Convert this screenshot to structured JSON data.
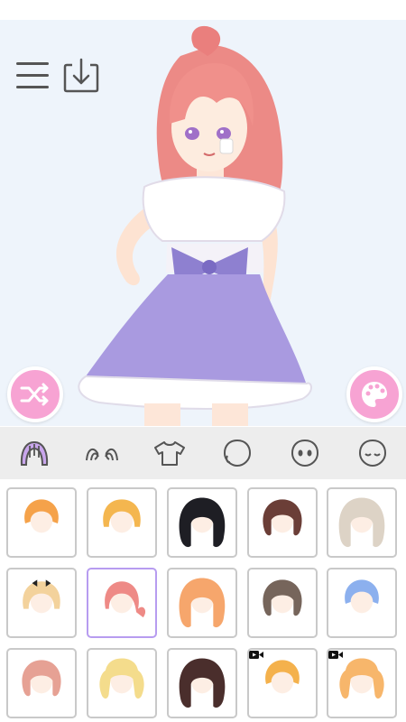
{
  "app": {
    "accent_color": "#f7a3d3",
    "selected_color": "#b79cf0"
  },
  "toolbar": {
    "menu_icon": "menu-icon",
    "download_icon": "download-icon"
  },
  "canvas_buttons": {
    "shuffle_icon": "shuffle-icon",
    "palette_icon": "palette-icon"
  },
  "tabs": [
    {
      "icon": "hair-icon",
      "selected": true
    },
    {
      "icon": "eyebrows-icon",
      "selected": false
    },
    {
      "icon": "shirt-icon",
      "selected": false
    },
    {
      "icon": "face-shape-icon",
      "selected": false
    },
    {
      "icon": "face-icon",
      "selected": false
    },
    {
      "icon": "head-icon",
      "selected": false
    }
  ],
  "hair_options": [
    {
      "color": "#f5a24a",
      "style": "short",
      "selected": false,
      "locked_video": false
    },
    {
      "color": "#f4b64f",
      "style": "bob",
      "selected": false,
      "locked_video": false
    },
    {
      "color": "#1e1e24",
      "style": "long",
      "selected": false,
      "locked_video": false
    },
    {
      "color": "#6b3e37",
      "style": "medium",
      "selected": false,
      "locked_video": false
    },
    {
      "color": "#ddd3c6",
      "style": "long",
      "selected": false,
      "locked_video": false
    },
    {
      "color": "#f3d29c",
      "style": "bob-ribbon",
      "selected": false,
      "locked_video": false
    },
    {
      "color": "#ee8a86",
      "style": "ponytail",
      "selected": true,
      "locked_video": false
    },
    {
      "color": "#f6a66c",
      "style": "long",
      "selected": false,
      "locked_video": false
    },
    {
      "color": "#76655b",
      "style": "medium",
      "selected": false,
      "locked_video": false
    },
    {
      "color": "#8cb0ee",
      "style": "short",
      "selected": false,
      "locked_video": false
    },
    {
      "color": "#e6a194",
      "style": "medium",
      "selected": false,
      "locked_video": false
    },
    {
      "color": "#f4dc8c",
      "style": "curly",
      "selected": false,
      "locked_video": false
    },
    {
      "color": "#4a2e2c",
      "style": "long",
      "selected": false,
      "locked_video": false
    },
    {
      "color": "#f4b14c",
      "style": "short",
      "selected": false,
      "locked_video": true
    },
    {
      "color": "#f7b66b",
      "style": "curly",
      "selected": false,
      "locked_video": true
    }
  ]
}
